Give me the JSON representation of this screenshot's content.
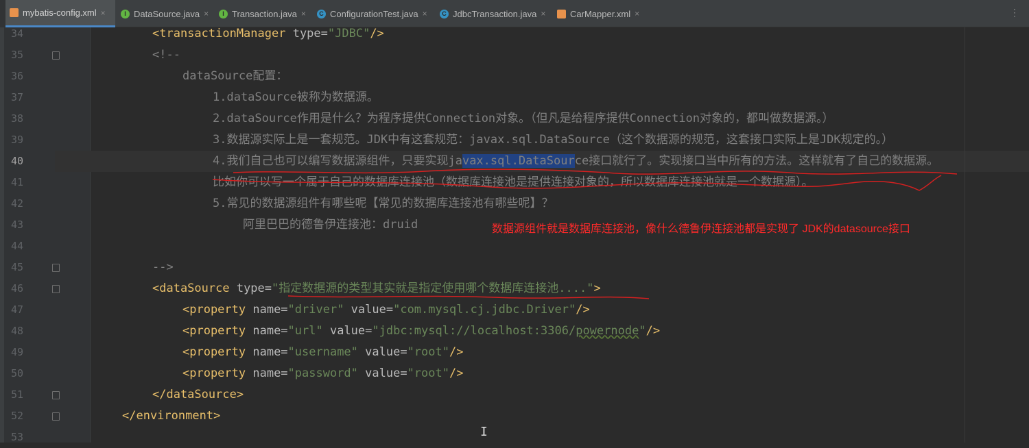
{
  "tabs": [
    {
      "label": "mybatis-config.xml",
      "icon": "xml-file-icon",
      "active": true
    },
    {
      "label": "DataSource.java",
      "icon": "interface-icon",
      "active": false
    },
    {
      "label": "Transaction.java",
      "icon": "interface-icon",
      "active": false
    },
    {
      "label": "ConfigurationTest.java",
      "icon": "class-icon",
      "active": false
    },
    {
      "label": "JdbcTransaction.java",
      "icon": "class-icon",
      "active": false
    },
    {
      "label": "CarMapper.xml",
      "icon": "xml-file-icon",
      "active": false
    }
  ],
  "tab_close_glyph": "×",
  "tab_menu_glyph": "⋮",
  "editor": {
    "current_line": "40",
    "line_numbers": [
      "34",
      "35",
      "36",
      "37",
      "38",
      "39",
      "40",
      "41",
      "42",
      "43",
      "44",
      "45",
      "46",
      "47",
      "48",
      "49",
      "50",
      "51",
      "52",
      "53"
    ],
    "code": {
      "l34_tag_open": "<transactionManager",
      "l34_attr": " type=",
      "l34_val": "\"JDBC\"",
      "l34_tag_close": "/>",
      "l35": "<!--",
      "l36": "dataSource配置：",
      "l37": "1.dataSource被称为数据源。",
      "l38": "2.dataSource作用是什么？为程序提供Connection对象。（但凡是给程序提供Connection对象的，都叫做数据源。）",
      "l39": "3.数据源实际上是一套规范。JDK中有这套规范：javax.sql.DataSource（这个数据源的规范，这套接口实际上是JDK规定的。）",
      "l40_a": "4.我们自己也可以编写数据源组件，只要实现ja",
      "l40_sel": "vax.sql.DataSour",
      "l40_b": "ce接口就行了。实现接口当中所有的方法。这样就有了自己的数据源。",
      "l41": "比如你可以写一个属于自己的数据库连接池（数据库连接池是提供连接对象的，所以数据库连接池就是一个数据源）。",
      "l42": "5.常见的数据源组件有哪些呢【常见的数据库连接池有哪些呢】？",
      "l43": "阿里巴巴的德鲁伊连接池：druid",
      "l45": "-->",
      "l46_tag": "<dataSource",
      "l46_attr": " type=",
      "l46_val": "\"指定数据源的类型其实就是指定使用哪个数据库连接池....\"",
      "l46_close": ">",
      "property_tag": "<property",
      "name_attr": " name=",
      "value_attr": " value=",
      "self_close": "/>",
      "l47_name": "\"driver\"",
      "l47_value": "\"com.mysql.cj.jdbc.Driver\"",
      "l48_name": "\"url\"",
      "l48_value_a": "\"jdbc:mysql://localhost:3306/",
      "l48_value_b": "powernode",
      "l48_value_c": "\"",
      "l49_name": "\"username\"",
      "l49_value": "\"root\"",
      "l50_name": "\"password\"",
      "l50_value": "\"root\"",
      "l51": "</dataSource>",
      "l52": "</environment>"
    },
    "annotation": "数据源组件就是数据库连接池，像什么德鲁伊连接池都是实现了 JDK的datasource接口",
    "mouse_cursor_glyph": "I"
  },
  "colors": {
    "background": "#2b2b2b",
    "tag": "#e8bf6a",
    "attribute": "#bababa",
    "string": "#6a8759",
    "comment": "#808080",
    "selection": "#214283",
    "annotation": "#ff2a2a"
  }
}
